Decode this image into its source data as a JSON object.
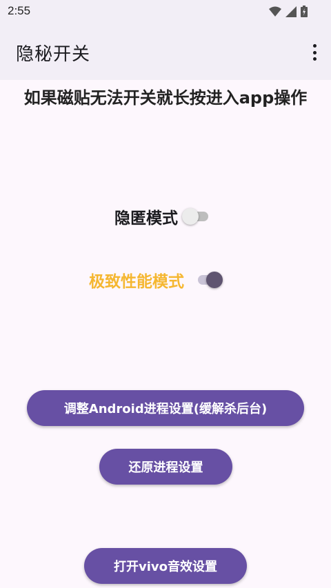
{
  "status": {
    "time": "2:55"
  },
  "appbar": {
    "title": "隐秘开关",
    "menu_icon": "more-vert-icon"
  },
  "hint": "如果磁贴无法开关就长按进入app操作",
  "toggles": [
    {
      "label": "隐匿模式",
      "state": false,
      "label_color": "#1b1b1f"
    },
    {
      "label": "极致性能模式",
      "state": true,
      "label_color": "#f5b731"
    }
  ],
  "buttons": {
    "adjust": "调整Android进程设置(缓解杀后台)",
    "restore": "还原进程设置",
    "vivo": "打开vivo音效设置"
  },
  "colors": {
    "accent": "#6750a4",
    "background": "#fdf7fd",
    "appbar": "#f2eef6"
  }
}
